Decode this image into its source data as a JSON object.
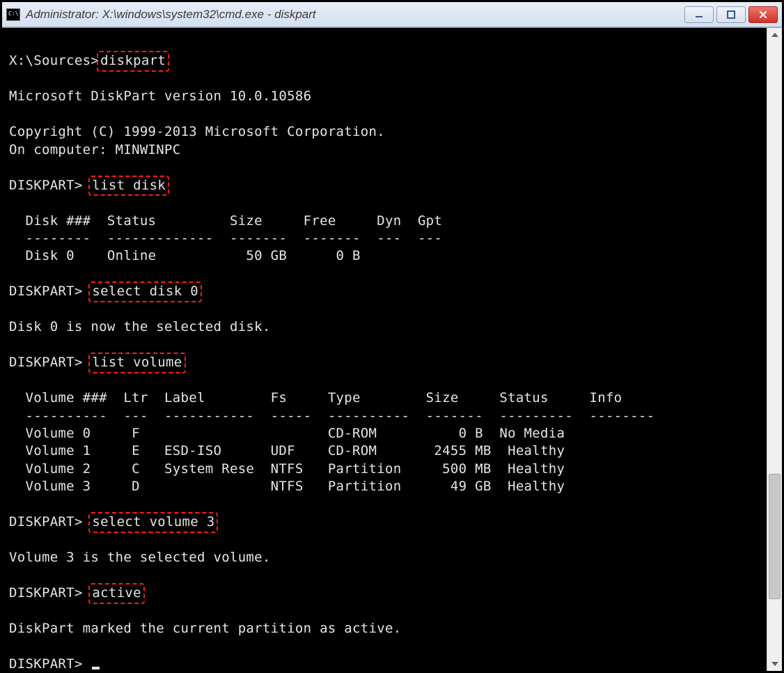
{
  "window": {
    "title": "Administrator: X:\\windows\\system32\\cmd.exe - diskpart"
  },
  "terminal": {
    "prompt_sources": "X:\\Sources>",
    "cmd_diskpart": "diskpart",
    "version_line": "Microsoft DiskPart version 10.0.10586",
    "copyright_line": "Copyright (C) 1999-2013 Microsoft Corporation.",
    "computer_line": "On computer: MINWINPC",
    "prompt_diskpart": "DISKPART> ",
    "cmd_list_disk": "list disk",
    "disk_header": "  Disk ###  Status         Size     Free     Dyn  Gpt",
    "disk_divider": "  --------  -------------  -------  -------  ---  ---",
    "disk_row0": "  Disk 0    Online           50 GB      0 B",
    "cmd_select_disk": "select disk 0",
    "msg_disk_selected": "Disk 0 is now the selected disk.",
    "cmd_list_volume": "list volume",
    "vol_header": "  Volume ###  Ltr  Label        Fs     Type        Size     Status     Info",
    "vol_divider": "  ----------  ---  -----------  -----  ----------  -------  ---------  --------",
    "vol_row0": "  Volume 0     F                       CD-ROM          0 B  No Media",
    "vol_row1": "  Volume 1     E   ESD-ISO      UDF    CD-ROM       2455 MB  Healthy",
    "vol_row2": "  Volume 2     C   System Rese  NTFS   Partition     500 MB  Healthy",
    "vol_row3": "  Volume 3     D                NTFS   Partition      49 GB  Healthy",
    "cmd_select_volume": "select volume 3",
    "msg_volume_selected": "Volume 3 is the selected volume.",
    "cmd_active": "active",
    "msg_active": "DiskPart marked the current partition as active."
  },
  "disk_table": {
    "columns": [
      "Disk ###",
      "Status",
      "Size",
      "Free",
      "Dyn",
      "Gpt"
    ],
    "rows": [
      {
        "disk": "Disk 0",
        "status": "Online",
        "size": "50 GB",
        "free": "0 B",
        "dyn": "",
        "gpt": ""
      }
    ]
  },
  "volume_table": {
    "columns": [
      "Volume ###",
      "Ltr",
      "Label",
      "Fs",
      "Type",
      "Size",
      "Status",
      "Info"
    ],
    "rows": [
      {
        "volume": "Volume 0",
        "ltr": "F",
        "label": "",
        "fs": "",
        "type": "CD-ROM",
        "size": "0 B",
        "status": "No Media",
        "info": ""
      },
      {
        "volume": "Volume 1",
        "ltr": "E",
        "label": "ESD-ISO",
        "fs": "UDF",
        "type": "CD-ROM",
        "size": "2455 MB",
        "status": "Healthy",
        "info": ""
      },
      {
        "volume": "Volume 2",
        "ltr": "C",
        "label": "System Rese",
        "fs": "NTFS",
        "type": "Partition",
        "size": "500 MB",
        "status": "Healthy",
        "info": ""
      },
      {
        "volume": "Volume 3",
        "ltr": "D",
        "label": "",
        "fs": "NTFS",
        "type": "Partition",
        "size": "49 GB",
        "status": "Healthy",
        "info": ""
      }
    ]
  },
  "annotations": {
    "highlighted_commands": [
      "diskpart",
      "list disk",
      "select disk 0",
      "list volume",
      "select volume 3",
      "active"
    ],
    "highlight_color": "#ff1a1a"
  }
}
